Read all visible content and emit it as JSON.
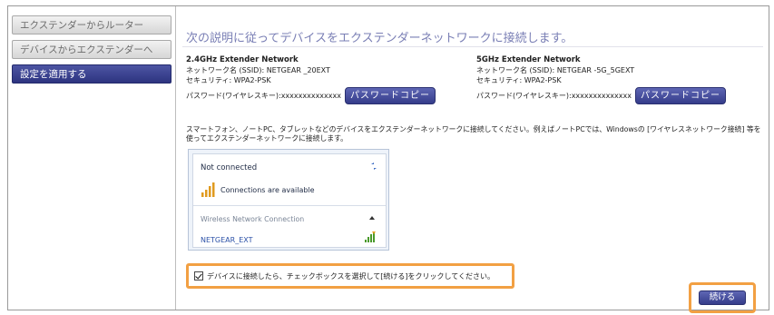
{
  "sidebar": {
    "items": [
      {
        "label": "エクステンダーからルーター",
        "active": false
      },
      {
        "label": "デバイスからエクステンダーへ",
        "active": false
      },
      {
        "label": "設定を適用する",
        "active": true
      }
    ]
  },
  "main": {
    "title": "次の説明に従ってデバイスをエクステンダーネットワークに接続します。",
    "network_24": {
      "heading": "2.4GHz Extender Network",
      "ssid": "ネットワーク名 (SSID): NETGEAR _20EXT",
      "security": "セキュリティ: WPA2-PSK",
      "password": "パスワード(ワイヤレスキー):xxxxxxxxxxxxxx",
      "copy_label": "パスワードコピー"
    },
    "network_5": {
      "heading": "5GHz Extender Network",
      "ssid": "ネットワーク名 (SSID): NETGEAR -5G_5GEXT",
      "security": "セキュリティ: WPA2-PSK",
      "password": "パスワード(ワイヤレスキー):xxxxxxxxxxxxxx",
      "copy_label": "パスワードコピー"
    },
    "instruction": "スマートフォン、ノートPC、タブレットなどのデバイスをエクステンダーネットワークに接続してください。例えばノートPCでは、Windowsの [ワイヤレスネットワーク接続] 等を使ってエクステンダーネットワークに接続します。",
    "windows_popup": {
      "status": "Not connected",
      "connections": "Connections are available",
      "section": "Wireless Network Connection",
      "network": "NETGEAR_EXT"
    },
    "agree": {
      "checked": true,
      "label": "デバイスに接続したら、チェックボックスを選択して[続ける]をクリックしてください。"
    },
    "continue_label": "続ける"
  },
  "colors": {
    "accent": "#353c8a",
    "highlight": "#f2a043",
    "title": "#7a7fb5"
  }
}
